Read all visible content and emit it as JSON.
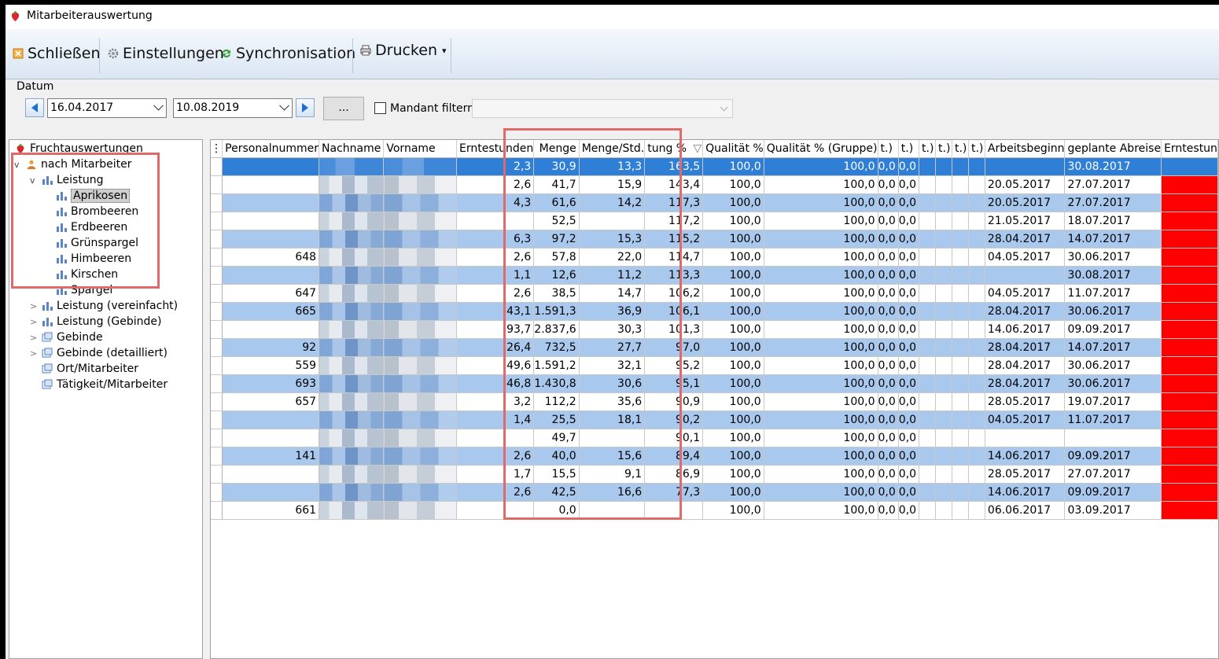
{
  "window": {
    "title": "Mitarbeiterauswertung"
  },
  "toolbar": {
    "close_label": "Schließen",
    "settings_label": "Einstellungen",
    "sync_label": "Synchronisation",
    "print_label": "Drucken",
    "print_dropdown": "▾"
  },
  "filter": {
    "datum_label": "Datum",
    "date_from": "16.04.2017",
    "date_to": "10.08.2019",
    "more_label": "...",
    "mandant_label": "Mandant filtern",
    "mandant_value": ""
  },
  "tree": {
    "root": "Fruchtauswertungen",
    "group": "nach Mitarbeiter",
    "leistung": "Leistung",
    "fruits": [
      "Aprikosen",
      "Brombeeren",
      "Erdbeeren",
      "Grünspargel",
      "Himbeeren",
      "Kirschen",
      "Spargel"
    ],
    "others": [
      "Leistung (vereinfacht)",
      "Leistung (Gebinde)",
      "Gebinde",
      "Gebinde (detailliert)",
      "Ort/Mitarbeiter",
      "Tätigkeit/Mitarbeiter"
    ],
    "expander_open": "v",
    "expander_closed": ">"
  },
  "grid": {
    "header_icon": "⋮",
    "row_marker": "▶",
    "columns": {
      "personalnummer": "Personalnummer",
      "nachname": "Nachname",
      "vorname": "Vorname",
      "erntestunden": "Erntestunden",
      "menge": "Menge",
      "menge_std": "Menge/Std.",
      "leistung": "tung %",
      "leistung_sort": "▽",
      "qualitaet": "Qualität %",
      "qualitaet_gruppe": "Qualität % (Gruppe)",
      "c1": "t.)",
      "c2": "t.)",
      "c3": "t.)",
      "c4": "t.)",
      "c5": "t.)",
      "c6": "t.)",
      "arbeitsbeginn": "Arbeitsbeginn",
      "abreise": "geplante Abreise",
      "erntestunden2": "Erntestun"
    },
    "rows": [
      {
        "pn": "",
        "es": "2,3",
        "me": "30,9",
        "ms": "13,3",
        "le": "163,5",
        "q": "100,0",
        "qg": "100,0",
        "a": "0,0",
        "b": "0,0",
        "ab": "",
        "ga": "30.08.2017",
        "red": false
      },
      {
        "pn": "",
        "es": "2,6",
        "me": "41,7",
        "ms": "15,9",
        "le": "143,4",
        "q": "100,0",
        "qg": "100,0",
        "a": "0,0",
        "b": "0,0",
        "ab": "20.05.2017",
        "ga": "27.07.2017",
        "red": true
      },
      {
        "pn": "",
        "es": "4,3",
        "me": "61,6",
        "ms": "14,2",
        "le": "117,3",
        "q": "100,0",
        "qg": "100,0",
        "a": "0,0",
        "b": "0,0",
        "ab": "20.05.2017",
        "ga": "27.07.2017",
        "red": true
      },
      {
        "pn": "",
        "es": "",
        "me": "52,5",
        "ms": "",
        "le": "117,2",
        "q": "100,0",
        "qg": "100,0",
        "a": "0,0",
        "b": "0,0",
        "ab": "21.05.2017",
        "ga": "18.07.2017",
        "red": true
      },
      {
        "pn": "",
        "es": "6,3",
        "me": "97,2",
        "ms": "15,3",
        "le": "115,2",
        "q": "100,0",
        "qg": "100,0",
        "a": "0,0",
        "b": "0,0",
        "ab": "28.04.2017",
        "ga": "14.07.2017",
        "red": true
      },
      {
        "pn": "648",
        "es": "2,6",
        "me": "57,8",
        "ms": "22,0",
        "le": "114,7",
        "q": "100,0",
        "qg": "100,0",
        "a": "0,0",
        "b": "0,0",
        "ab": "04.05.2017",
        "ga": "30.06.2017",
        "red": true
      },
      {
        "pn": "",
        "es": "1,1",
        "me": "12,6",
        "ms": "11,2",
        "le": "113,3",
        "q": "100,0",
        "qg": "100,0",
        "a": "0,0",
        "b": "0,0",
        "ab": "",
        "ga": "30.08.2017",
        "red": true
      },
      {
        "pn": "647",
        "es": "2,6",
        "me": "38,5",
        "ms": "14,7",
        "le": "106,2",
        "q": "100,0",
        "qg": "100,0",
        "a": "0,0",
        "b": "0,0",
        "ab": "04.05.2017",
        "ga": "11.07.2017",
        "red": true
      },
      {
        "pn": "665",
        "es": "43,1",
        "me": "1.591,3",
        "ms": "36,9",
        "le": "106,1",
        "q": "100,0",
        "qg": "100,0",
        "a": "0,0",
        "b": "0,0",
        "ab": "28.04.2017",
        "ga": "30.06.2017",
        "red": true
      },
      {
        "pn": "",
        "es": "93,7",
        "me": "2.837,6",
        "ms": "30,3",
        "le": "101,3",
        "q": "100,0",
        "qg": "100,0",
        "a": "0,0",
        "b": "0,0",
        "ab": "14.06.2017",
        "ga": "09.09.2017",
        "red": true
      },
      {
        "pn": "92",
        "es": "26,4",
        "me": "732,5",
        "ms": "27,7",
        "le": "97,0",
        "q": "100,0",
        "qg": "100,0",
        "a": "0,0",
        "b": "0,0",
        "ab": "28.04.2017",
        "ga": "14.07.2017",
        "red": true
      },
      {
        "pn": "559",
        "es": "49,6",
        "me": "1.591,2",
        "ms": "32,1",
        "le": "95,2",
        "q": "100,0",
        "qg": "100,0",
        "a": "0,0",
        "b": "0,0",
        "ab": "28.04.2017",
        "ga": "30.06.2017",
        "red": true
      },
      {
        "pn": "693",
        "es": "46,8",
        "me": "1.430,8",
        "ms": "30,6",
        "le": "95,1",
        "q": "100,0",
        "qg": "100,0",
        "a": "0,0",
        "b": "0,0",
        "ab": "28.04.2017",
        "ga": "30.06.2017",
        "red": true
      },
      {
        "pn": "657",
        "es": "3,2",
        "me": "112,2",
        "ms": "35,6",
        "le": "90,9",
        "q": "100,0",
        "qg": "100,0",
        "a": "0,0",
        "b": "0,0",
        "ab": "28.05.2017",
        "ga": "19.07.2017",
        "red": true
      },
      {
        "pn": "",
        "es": "1,4",
        "me": "25,5",
        "ms": "18,1",
        "le": "90,2",
        "q": "100,0",
        "qg": "100,0",
        "a": "0,0",
        "b": "0,0",
        "ab": "04.05.2017",
        "ga": "11.07.2017",
        "red": true
      },
      {
        "pn": "",
        "es": "",
        "me": "49,7",
        "ms": "",
        "le": "90,1",
        "q": "100,0",
        "qg": "100,0",
        "a": "0,0",
        "b": "0,0",
        "ab": "",
        "ga": "",
        "red": true
      },
      {
        "pn": "141",
        "es": "2,6",
        "me": "40,0",
        "ms": "15,6",
        "le": "89,4",
        "q": "100,0",
        "qg": "100,0",
        "a": "0,0",
        "b": "0,0",
        "ab": "14.06.2017",
        "ga": "09.09.2017",
        "red": true
      },
      {
        "pn": "",
        "es": "1,7",
        "me": "15,5",
        "ms": "9,1",
        "le": "86,9",
        "q": "100,0",
        "qg": "100,0",
        "a": "0,0",
        "b": "0,0",
        "ab": "28.05.2017",
        "ga": "27.07.2017",
        "red": true
      },
      {
        "pn": "",
        "es": "2,6",
        "me": "42,5",
        "ms": "16,6",
        "le": "77,3",
        "q": "100,0",
        "qg": "100,0",
        "a": "0,0",
        "b": "0,0",
        "ab": "14.06.2017",
        "ga": "09.09.2017",
        "red": true
      },
      {
        "pn": "661",
        "es": "",
        "me": "0,0",
        "ms": "",
        "le": "",
        "q": "100,0",
        "qg": "100,0",
        "a": "0,0",
        "b": "0,0",
        "ab": "06.06.2017",
        "ga": "03.09.2017",
        "red": true
      }
    ]
  },
  "colors": {
    "selected_row": "#2f7fd6",
    "alt_row": "#a9c8ee",
    "highlight": "#e06a6a",
    "status_red": "#ff0000"
  }
}
